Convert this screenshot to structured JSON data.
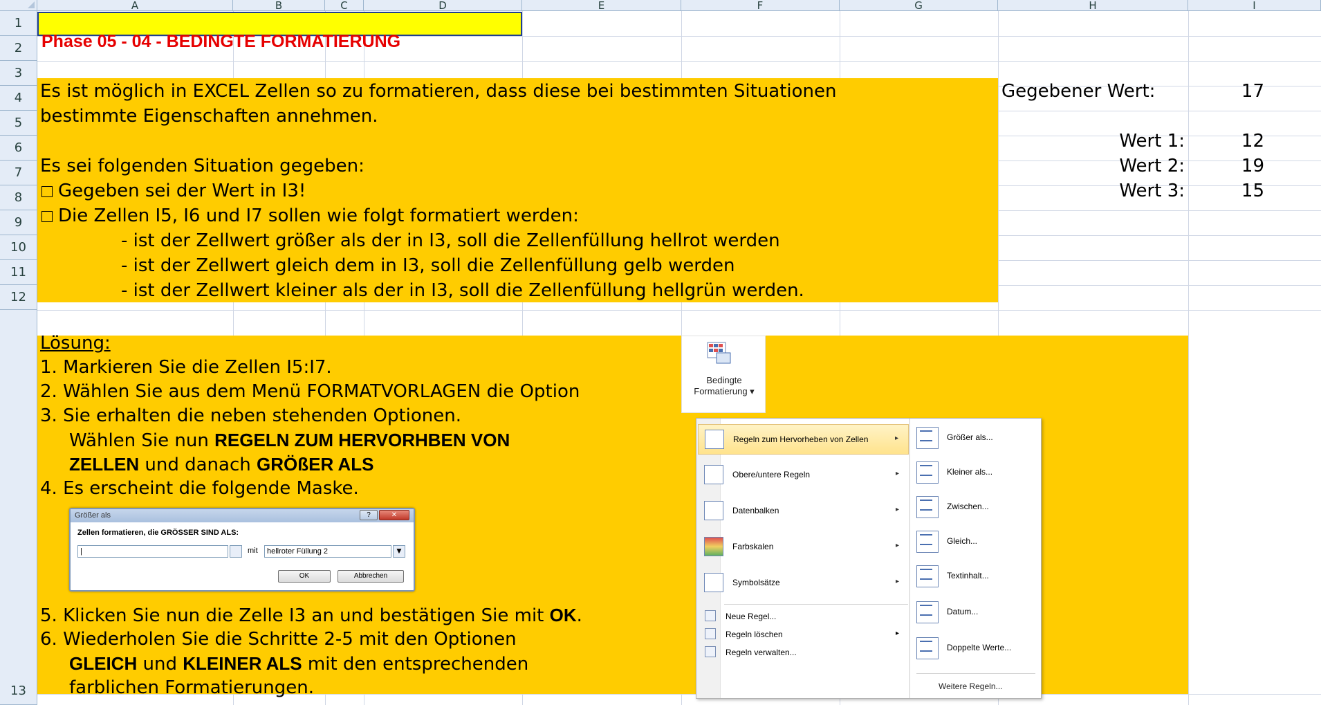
{
  "columns": [
    "A",
    "B",
    "C",
    "D",
    "E",
    "F",
    "G",
    "H",
    "I"
  ],
  "rows": [
    "1",
    "2",
    "3",
    "4",
    "5",
    "6",
    "7",
    "8",
    "9",
    "10",
    "11",
    "12",
    "13"
  ],
  "cell_a1": "Phase 05 - 04 - BEDINGTE FORMATIERUNG",
  "intro": {
    "line3": "Es ist möglich in EXCEL Zellen so zu formatieren, dass diese bei bestimmten Situationen",
    "line4": "bestimmte Eigenschaften annehmen.",
    "line6": "Es sei folgenden Situation gegeben:",
    "line7": "Gegeben sei der Wert in I3!",
    "line8": "Die Zellen I5, I6 und I7 sollen wie folgt formatiert werden:",
    "line9": "- ist der Zellwert größer als der in I3, soll die Zellenfüllung hellrot werden",
    "line10": "- ist der Zellwert gleich dem in I3, soll die Zellenfüllung gelb werden",
    "line11": "- ist der Zellwert kleiner als der in I3, soll die Zellenfüllung hellgrün werden."
  },
  "values": {
    "given_label": "Gegebener Wert:",
    "given_value": "17",
    "w1_label": "Wert 1:",
    "w1_value": "12",
    "w2_label": "Wert 2:",
    "w2_value": "19",
    "w3_label": "Wert 3:",
    "w3_value": "15"
  },
  "solution": {
    "heading": "Lösung:",
    "s1": "1. Markieren Sie die Zellen I5:I7.",
    "s2": "2. Wählen Sie aus dem Menü FORMATVORLAGEN die Option",
    "s3": "3. Sie erhalten die neben stehenden Optionen.",
    "s3b_pre": "Wählen Sie nun ",
    "s3b_bold": "REGELN ZUM HERVORHBEN VON",
    "s3c_bold": "ZELLEN",
    "s3c_mid": " und danach ",
    "s3c_bold2": "GRÖßER ALS",
    "s4": "4. Es erscheint die folgende Maske.",
    "s5_pre": "5. Klicken Sie nun die Zelle I3 an und bestätigen Sie mit ",
    "s5_bold": "OK",
    "s5_post": ".",
    "s6": "6. Wiederholen Sie die Schritte 2-5 mit den Optionen",
    "s6b_bold1": "GLEICH",
    "s6b_mid": " und ",
    "s6b_bold2": "KLEINER ALS",
    "s6b_post": " mit den entsprechenden",
    "s6c": "farblichen Formatierungen."
  },
  "ribbon": {
    "line1": "Bedingte",
    "line2": "Formatierung ▾"
  },
  "menu": {
    "items": [
      {
        "label": "Regeln zum Hervorheben von Zellen"
      },
      {
        "label": "Obere/untere Regeln"
      },
      {
        "label": "Datenbalken"
      },
      {
        "label": "Farbskalen"
      },
      {
        "label": "Symbolsätze"
      }
    ],
    "small": [
      "Neue Regel...",
      "Regeln löschen",
      "Regeln verwalten..."
    ],
    "submenu": [
      "Größer als...",
      "Kleiner als...",
      "Zwischen...",
      "Gleich...",
      "Textinhalt...",
      "Datum...",
      "Doppelte Werte..."
    ],
    "more": "Weitere Regeln..."
  },
  "dialog": {
    "title": "Größer als",
    "prompt": "Zellen formatieren, die GRÖSSER SIND ALS:",
    "input_value": "|",
    "mit": "mit",
    "select_value": "hellroter Füllung 2",
    "ok": "OK",
    "cancel": "Abbrechen"
  }
}
